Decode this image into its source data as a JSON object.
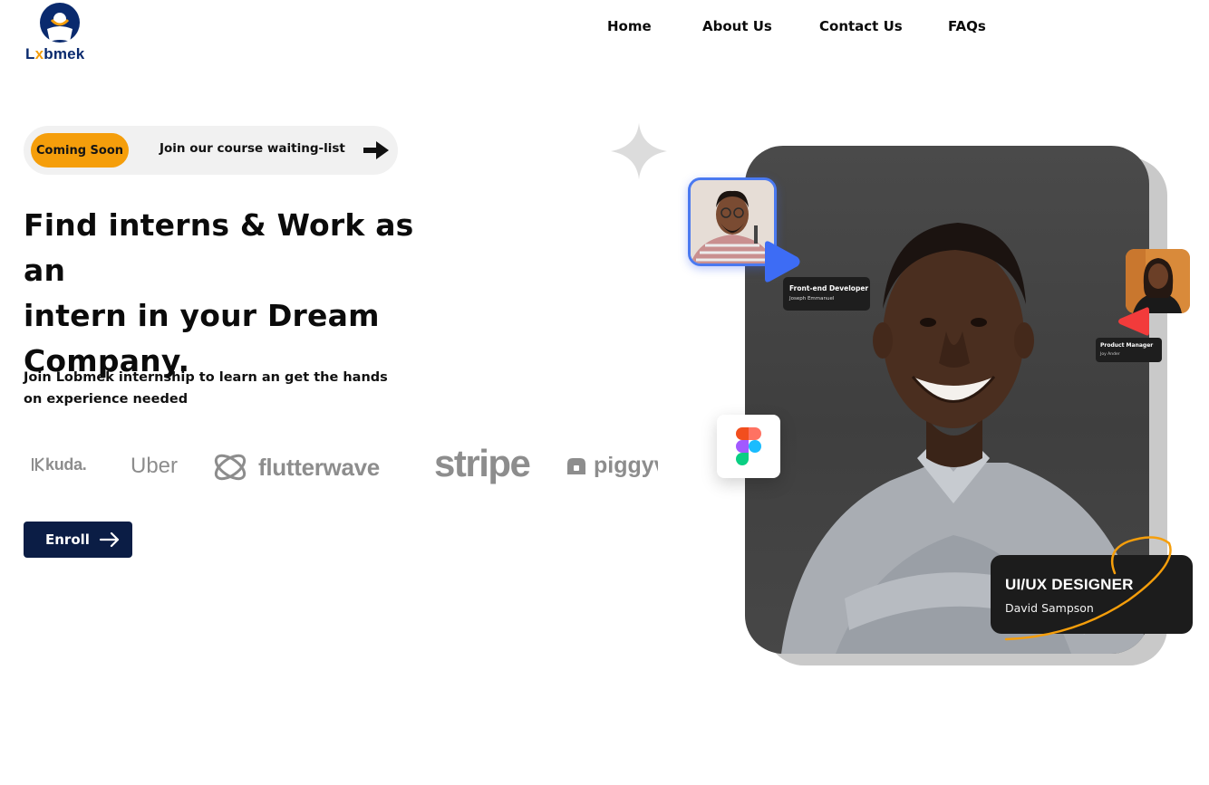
{
  "brand": {
    "logo_prefix": "L",
    "logo_x": "x",
    "logo_suffix": "bmek"
  },
  "nav": {
    "items": [
      "Home",
      "About Us",
      "Contact Us",
      "FAQs"
    ]
  },
  "announcement": {
    "badge": "Coming Soon",
    "text": "Join our course waiting-list"
  },
  "hero": {
    "headline_line1": "Find interns & Work as an",
    "headline_line2": "intern in your Dream",
    "headline_line3": "Company.",
    "subtext": "Join Lobmek internship to learn an get the hands on experience needed",
    "cta_label": "Enroll"
  },
  "partners": [
    "kuda.",
    "Uber",
    "flutterwave",
    "stripe",
    "piggyv"
  ],
  "profiles": {
    "dev": {
      "role": "Front-end Developer",
      "name": "Joseph Emmanuel"
    },
    "pm": {
      "role": "Product Manager",
      "name": "Joy Ander"
    },
    "featured": {
      "role": "UI/UX DESIGNER",
      "name": "David Sampson"
    }
  },
  "colors": {
    "accent": "#f59e0b",
    "navy": "#0b1d45",
    "brand_logo": "#0a2a6e",
    "partner_grey": "#8d8d8d",
    "card_dark": "#1c1c1c",
    "play_blue": "#3d6cf5",
    "play_red": "#f23b3b"
  }
}
